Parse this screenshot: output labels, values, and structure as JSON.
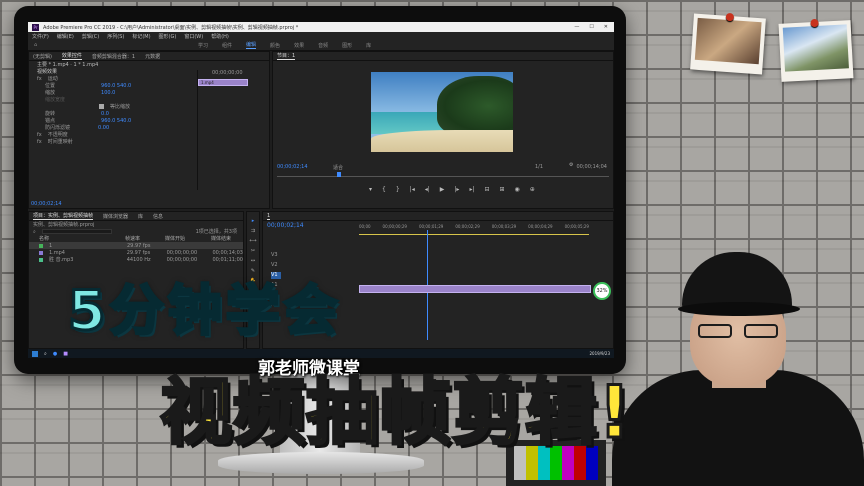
{
  "app": {
    "title": "Adobe Premiere Pro CC 2019 - C:\\用户\\Administrator\\桌面\\实例、剪辑视频抽帧\\实例、剪辑视频抽帧.prproj *",
    "logo": "Pr",
    "menu": [
      "文件(F)",
      "编辑(E)",
      "剪辑(C)",
      "序列(S)",
      "标记(M)",
      "图形(G)",
      "窗口(W)",
      "帮助(H)"
    ],
    "workspaces": [
      "学习",
      "组件",
      "编辑",
      "颜色",
      "效果",
      "音频",
      "图形",
      "库"
    ],
    "active_workspace": "编辑"
  },
  "effect_controls": {
    "tabs": [
      "(无剪辑)",
      "效果控件",
      "音频剪辑混合器：1",
      "元数据"
    ],
    "clip": "主要 * 1.mp4  ·  1 * 1.mp4",
    "section": "视频效果",
    "rows": [
      {
        "label": "运动",
        "value": ""
      },
      {
        "label": "位置",
        "value": "960.0   540.0"
      },
      {
        "label": "缩放",
        "value": "100.0"
      },
      {
        "label": "缩放宽度",
        "value": ""
      },
      {
        "label": "等比缩放",
        "value": ""
      },
      {
        "label": "旋转",
        "value": "0.0"
      },
      {
        "label": "锚点",
        "value": "960.0   540.0"
      },
      {
        "label": "防闪烁滤镜",
        "value": "0.00"
      },
      {
        "label": "不透明度",
        "value": ""
      },
      {
        "label": "时间重映射",
        "value": ""
      }
    ],
    "timecode": "00;00;00;00",
    "clip_label": "1.mp4",
    "bottom_timecode": "00;00;02;14"
  },
  "program": {
    "title": "节目：1",
    "timecode": "00;00;02;14",
    "fit": "适合",
    "scale": "1/1",
    "duration": "00;00;14;04"
  },
  "project": {
    "tabs": [
      "项目：实例、剪辑视频抽帧",
      "媒体浏览器",
      "库",
      "信息"
    ],
    "path": "实例、剪辑视频抽帧.prproj",
    "count": "1项已选择，共3项",
    "columns": [
      "名称",
      "帧速率",
      "媒体开始",
      "媒体结束"
    ],
    "items": [
      {
        "name": "1",
        "fps": "29.97 fps",
        "start": "",
        "end": ""
      },
      {
        "name": "1.mp4",
        "fps": "29.97 fps",
        "start": "00;00;00;00",
        "end": "00;00;14;03"
      },
      {
        "name": "胜 音.mp3",
        "fps": "44100 Hz",
        "start": "00;00;00;00",
        "end": "00;01;11;00"
      }
    ]
  },
  "timeline": {
    "title": "1",
    "timecode": "00;00;02;14",
    "ruler": [
      "00;00",
      "00;00;00;29",
      "00;00;01;29",
      "00;00;02;29",
      "00;00;03;29",
      "00;00;04;29",
      "00;00;05;29"
    ],
    "tracks": [
      "V3",
      "V2",
      "V1",
      "A1",
      "A2",
      "A3"
    ],
    "badge": "32%"
  },
  "taskbar": {
    "clock": "2019/9/23"
  },
  "overlay": {
    "headline": "5分钟学会",
    "channel": "郭老师微课堂",
    "main_title": "视频抽帧剪辑!"
  }
}
